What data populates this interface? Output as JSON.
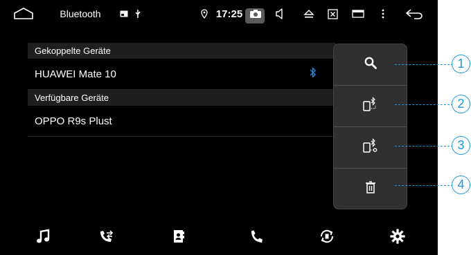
{
  "status_bar": {
    "title": "Bluetooth",
    "time": "17:25",
    "icons": [
      "home-icon",
      "image-icon",
      "usb-icon",
      "location-pin-icon",
      "camera-icon",
      "volume-icon",
      "eject-icon",
      "close-box-icon",
      "window-icon",
      "more-icon",
      "back-icon"
    ]
  },
  "lists": {
    "paired_header": "Gekoppelte Geräte",
    "paired_devices": [
      {
        "name": "HUAWEI Mate 10",
        "icon": "bluetooth-icon"
      }
    ],
    "available_header": "Verfügbare Geräte",
    "available_devices": [
      {
        "name": "OPPO R9s Plust"
      }
    ]
  },
  "side_panel": {
    "buttons": [
      {
        "icon": "search-icon"
      },
      {
        "icon": "phone-bluetooth-connect-icon"
      },
      {
        "icon": "phone-bluetooth-settings-icon"
      },
      {
        "icon": "trash-icon"
      }
    ]
  },
  "bottom_bar": {
    "buttons": [
      {
        "icon": "music-note-icon"
      },
      {
        "icon": "call-log-icon"
      },
      {
        "icon": "contacts-book-icon"
      },
      {
        "icon": "phone-icon"
      },
      {
        "icon": "sync-icon"
      },
      {
        "icon": "gear-icon"
      }
    ]
  },
  "callouts": [
    "1",
    "2",
    "3",
    "4"
  ],
  "colors": {
    "screen_bg": "#000000",
    "panel_bg": "#303030",
    "accent_bluetooth": "#1e88e5",
    "callout": "#1a9bd7"
  }
}
